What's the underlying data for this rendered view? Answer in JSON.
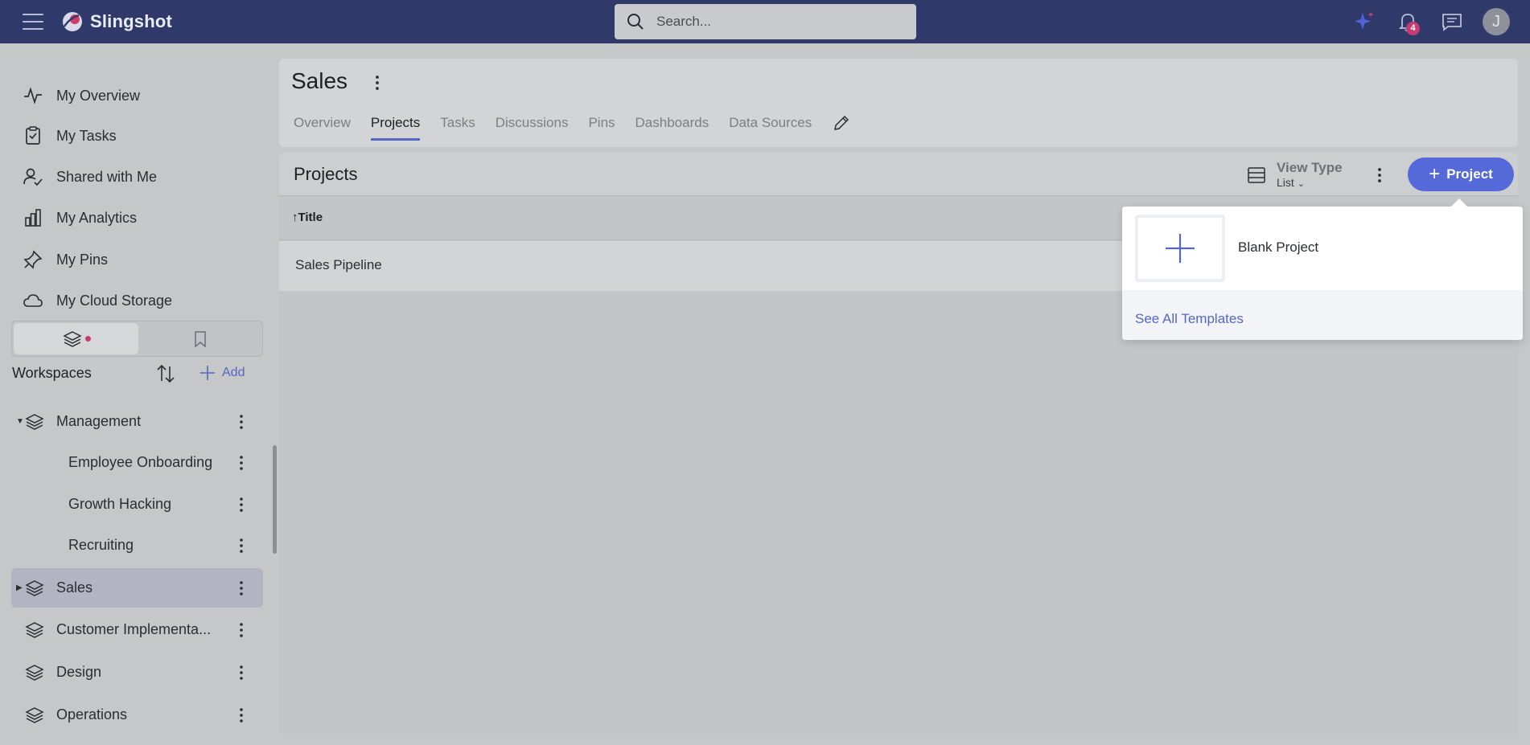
{
  "app": {
    "brand": "Slingshot",
    "search_placeholder": "Search...",
    "notification_count": "4",
    "avatar_initial": "J"
  },
  "sidebar": {
    "nav": [
      {
        "label": "My Overview",
        "icon": "activity-icon"
      },
      {
        "label": "My Tasks",
        "icon": "task-clipboard-icon"
      },
      {
        "label": "Shared with Me",
        "icon": "user-check-icon"
      },
      {
        "label": "My Analytics",
        "icon": "bar-chart-icon"
      },
      {
        "label": "My Pins",
        "icon": "pin-icon"
      },
      {
        "label": "My Cloud Storage",
        "icon": "cloud-icon"
      }
    ],
    "workspaces_title": "Workspaces",
    "add_label": "Add",
    "workspaces": [
      {
        "name": "Management",
        "level": 0,
        "expanded": true
      },
      {
        "name": "Employee Onboarding",
        "level": 1
      },
      {
        "name": "Growth Hacking",
        "level": 1
      },
      {
        "name": "Recruiting",
        "level": 1
      },
      {
        "name": "Sales",
        "level": 0,
        "selected": true
      },
      {
        "name": "Customer Implementa...",
        "level": 0
      },
      {
        "name": "Design",
        "level": 0
      },
      {
        "name": "Operations",
        "level": 0
      }
    ]
  },
  "header": {
    "title": "Sales",
    "tabs": [
      "Overview",
      "Projects",
      "Tasks",
      "Discussions",
      "Pins",
      "Dashboards",
      "Data Sources"
    ],
    "active_tab": "Projects"
  },
  "projects_panel": {
    "title": "Projects",
    "view_type_label": "View Type",
    "view_type_value": "List",
    "new_button_label": "Project",
    "column_title": "Title",
    "rows": [
      "Sales Pipeline"
    ]
  },
  "new_project_menu": {
    "blank_label": "Blank Project",
    "templates_link": "See All Templates"
  },
  "colors": {
    "topbar": "#2f3a6b",
    "accent": "#5569d9",
    "badge": "#c43c73"
  }
}
